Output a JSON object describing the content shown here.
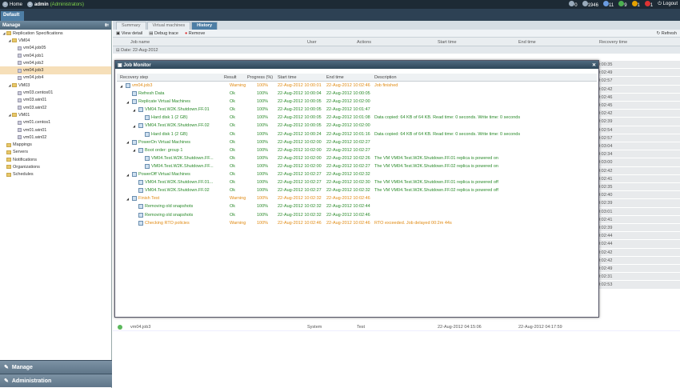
{
  "topbar": {
    "home": "Home",
    "user": "admin",
    "role": "(Administrators)",
    "counts": [
      {
        "icon": "gear-icon",
        "value": "0"
      },
      {
        "icon": "clock-icon",
        "value": "1946"
      },
      {
        "icon": "server-icon",
        "value": "11"
      },
      {
        "icon": "check-icon",
        "value": "9"
      },
      {
        "icon": "warning-icon",
        "value": "1"
      },
      {
        "icon": "error-icon",
        "value": "1"
      }
    ],
    "logout": "Logout"
  },
  "tabs": {
    "default": "Default"
  },
  "sidebar": {
    "title": "Manage",
    "tree": [
      {
        "label": "Replication Specifications",
        "depth": 0,
        "type": "root"
      },
      {
        "label": "VM04",
        "depth": 1,
        "type": "folder"
      },
      {
        "label": "vm04.job05",
        "depth": 2,
        "type": "vm"
      },
      {
        "label": "vm04.job1",
        "depth": 2,
        "type": "vm"
      },
      {
        "label": "vm04.job2",
        "depth": 2,
        "type": "vm"
      },
      {
        "label": "vm04.job3",
        "depth": 2,
        "type": "vm",
        "selected": true
      },
      {
        "label": "vm04.job4",
        "depth": 2,
        "type": "vm"
      },
      {
        "label": "VM03",
        "depth": 1,
        "type": "folder"
      },
      {
        "label": "vm03.centos01",
        "depth": 2,
        "type": "vm"
      },
      {
        "label": "vm03.win01",
        "depth": 2,
        "type": "vm"
      },
      {
        "label": "vm03.win02",
        "depth": 2,
        "type": "vm"
      },
      {
        "label": "VM01",
        "depth": 1,
        "type": "folder"
      },
      {
        "label": "vm01.centos1",
        "depth": 2,
        "type": "vm"
      },
      {
        "label": "vm01.win01",
        "depth": 2,
        "type": "vm"
      },
      {
        "label": "vm01.win02",
        "depth": 2,
        "type": "vm"
      },
      {
        "label": "Mappings",
        "depth": 0,
        "type": "item"
      },
      {
        "label": "Servers",
        "depth": 0,
        "type": "item"
      },
      {
        "label": "Notifications",
        "depth": 0,
        "type": "item"
      },
      {
        "label": "Organizations",
        "depth": 0,
        "type": "item"
      },
      {
        "label": "Schedules",
        "depth": 0,
        "type": "item"
      }
    ],
    "bottom": {
      "manage": "Manage",
      "administration": "Administration"
    }
  },
  "subtabs": [
    "Summary",
    "Virtual machines",
    "History"
  ],
  "toolbar": {
    "view_detail": "View detail",
    "debug_trace": "Debug trace",
    "remove": "Remove",
    "refresh": "Refresh"
  },
  "grid": {
    "headers": [
      "Job name",
      "User",
      "Actions",
      "Start time",
      "End time",
      "Recovery time"
    ],
    "date_group": "Date: 22-Aug-2012",
    "recovery_times": [
      "00:00:35",
      "00:02:49",
      "00:02:57",
      "00:02:42",
      "00:02:46",
      "00:02:45",
      "00:02:42",
      "00:02:39",
      "00:02:54",
      "00:02:57",
      "00:03:04",
      "00:02:34",
      "00:03:00",
      "00:02:42",
      "00:02:41",
      "00:02:35",
      "00:02:40",
      "00:02:39",
      "00:03:01",
      "00:02:41",
      "00:02:39",
      "00:02:44",
      "00:02:44",
      "00:02:42",
      "00:02:42",
      "00:02:49",
      "00:02:31",
      "00:02:53"
    ],
    "bottom_rows": [
      {
        "job": "vm04.job3",
        "user": "System",
        "action": "Test",
        "start": "22-Aug-2012 04:15:06",
        "end": "22-Aug-2012 04:17:59",
        "rt": "00:02:53"
      }
    ]
  },
  "monitor": {
    "title": "Job Monitor",
    "headers": [
      "Recovery step",
      "Result",
      "Progress (%)",
      "Start time",
      "End time",
      "Description"
    ],
    "rows": [
      {
        "step": "vm04.job3",
        "d": 0,
        "tri": "▲",
        "result": "Warning",
        "p": "100%",
        "start": "22-Aug-2012 10:00:01",
        "end": "22-Aug-2012 10:02:46",
        "desc": "Job finished",
        "warn": true
      },
      {
        "step": "Refresh Data",
        "d": 1,
        "tri": "",
        "result": "Ok",
        "p": "100%",
        "start": "22-Aug-2012 10:00:04",
        "end": "22-Aug-2012 10:00:05",
        "desc": ""
      },
      {
        "step": "Replicate Virtual Machines",
        "d": 1,
        "tri": "▲",
        "result": "Ok",
        "p": "100%",
        "start": "22-Aug-2012 10:00:05",
        "end": "22-Aug-2012 10:02:00",
        "desc": ""
      },
      {
        "step": "VM04.Test.W2K.Shutdown.FF.01",
        "d": 2,
        "tri": "▲",
        "result": "Ok",
        "p": "100%",
        "start": "22-Aug-2012 10:00:05",
        "end": "22-Aug-2012 10:01:47",
        "desc": ""
      },
      {
        "step": "Hard disk 1 (2 GB)",
        "d": 3,
        "tri": "",
        "result": "Ok",
        "p": "100%",
        "start": "22-Aug-2012 10:00:05",
        "end": "22-Aug-2012 10:01:08",
        "desc": "Data copied: 64 KB of 64 KB. Read time: 0 seconds. Write time: 0 seconds"
      },
      {
        "step": "VM04.Test.W2K.Shutdown.FF.02",
        "d": 2,
        "tri": "▲",
        "result": "Ok",
        "p": "100%",
        "start": "22-Aug-2012 10:00:05",
        "end": "22-Aug-2012 10:02:00",
        "desc": ""
      },
      {
        "step": "Hard disk 1 (2 GB)",
        "d": 3,
        "tri": "",
        "result": "Ok",
        "p": "100%",
        "start": "22-Aug-2012 10:00:24",
        "end": "22-Aug-2012 10:01:16",
        "desc": "Data copied: 64 KB of 64 KB. Read time: 0 seconds. Write time: 0 seconds"
      },
      {
        "step": "PowerOn Virtual Machines",
        "d": 1,
        "tri": "▲",
        "result": "Ok",
        "p": "100%",
        "start": "22-Aug-2012 10:02:00",
        "end": "22-Aug-2012 10:02:27",
        "desc": ""
      },
      {
        "step": "Boot order: group 1",
        "d": 2,
        "tri": "▲",
        "result": "Ok",
        "p": "100%",
        "start": "22-Aug-2012 10:02:00",
        "end": "22-Aug-2012 10:02:27",
        "desc": ""
      },
      {
        "step": "VM04.Test.W2K.Shutdown.FF...",
        "d": 3,
        "tri": "",
        "result": "Ok",
        "p": "100%",
        "start": "22-Aug-2012 10:02:00",
        "end": "22-Aug-2012 10:02:26",
        "desc": "The VM VM04.Test.W2K.Shutdown.FF.01 replica is powered on"
      },
      {
        "step": "VM04.Test.W2K.Shutdown.FF...",
        "d": 3,
        "tri": "",
        "result": "Ok",
        "p": "100%",
        "start": "22-Aug-2012 10:02:00",
        "end": "22-Aug-2012 10:02:27",
        "desc": "The VM VM04.Test.W2K.Shutdown.FF.02 replica is powered on"
      },
      {
        "step": "PowerOff Virtual Machines",
        "d": 1,
        "tri": "▲",
        "result": "Ok",
        "p": "100%",
        "start": "22-Aug-2012 10:02:27",
        "end": "22-Aug-2012 10:02:32",
        "desc": ""
      },
      {
        "step": "VM04.Test.W2K.Shutdown.FF.01...",
        "d": 2,
        "tri": "",
        "result": "Ok",
        "p": "100%",
        "start": "22-Aug-2012 10:02:27",
        "end": "22-Aug-2012 10:02:30",
        "desc": "The VM VM04.Test.W2K.Shutdown.FF.01 replica is powered off"
      },
      {
        "step": "VM04.Test.W2K.Shutdown.FF.02",
        "d": 2,
        "tri": "",
        "result": "Ok",
        "p": "100%",
        "start": "22-Aug-2012 10:02:27",
        "end": "22-Aug-2012 10:02:32",
        "desc": "The VM VM04.Test.W2K.Shutdown.FF.02 replica is powered off"
      },
      {
        "step": "Finish Test",
        "d": 1,
        "tri": "▲",
        "result": "Warning",
        "p": "100%",
        "start": "22-Aug-2012 10:02:32",
        "end": "22-Aug-2012 10:02:46",
        "desc": "",
        "warn": true
      },
      {
        "step": "Removing old snapshots",
        "d": 2,
        "tri": "",
        "result": "Ok",
        "p": "100%",
        "start": "22-Aug-2012 10:02:32",
        "end": "22-Aug-2012 10:02:44",
        "desc": ""
      },
      {
        "step": "Removing old snapshots",
        "d": 2,
        "tri": "",
        "result": "Ok",
        "p": "100%",
        "start": "22-Aug-2012 10:02:32",
        "end": "22-Aug-2012 10:02:46",
        "desc": ""
      },
      {
        "step": "Checking RTO policies",
        "d": 2,
        "tri": "",
        "result": "Warning",
        "p": "100%",
        "start": "22-Aug-2012 10:02:46",
        "end": "22-Aug-2012 10:02:46",
        "desc": "RTO exceeded. Job delayed 00:2m 44s",
        "warn": true
      }
    ]
  }
}
